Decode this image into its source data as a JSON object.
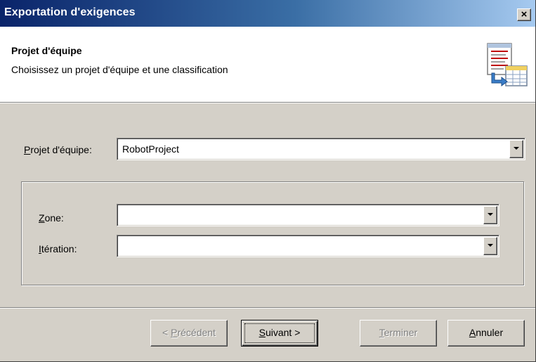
{
  "window": {
    "title": "Exportation d'exigences",
    "close_label": "×"
  },
  "header": {
    "title": "Projet d'équipe",
    "subtitle": "Choisissez un projet et une classification",
    "subtitle_full": "Choisissez un projet d'équipe et une classification",
    "icon": "export-requirements-icon"
  },
  "form": {
    "team_project": {
      "label_first": "P",
      "label_rest": "rojet d'équipe:",
      "value": "RobotProject"
    },
    "area": {
      "label_first": "Z",
      "label_rest": "one:",
      "value": ""
    },
    "iteration": {
      "label_first": "I",
      "label_rest": "tération:",
      "value": ""
    }
  },
  "buttons": {
    "previous": {
      "pre": "< ",
      "accel": "P",
      "rest": "récédent",
      "enabled": false
    },
    "next": {
      "accel": "S",
      "rest": "uivant >",
      "enabled": true
    },
    "finish": {
      "accel": "T",
      "rest": "erminer",
      "enabled": false
    },
    "cancel": {
      "accel": "A",
      "rest": "nnuler",
      "enabled": true
    }
  },
  "colors": {
    "dialog_face": "#d4d0c8",
    "titlebar_start": "#0a246a",
    "titlebar_end": "#a6caf0",
    "disabled_text": "#808080"
  }
}
